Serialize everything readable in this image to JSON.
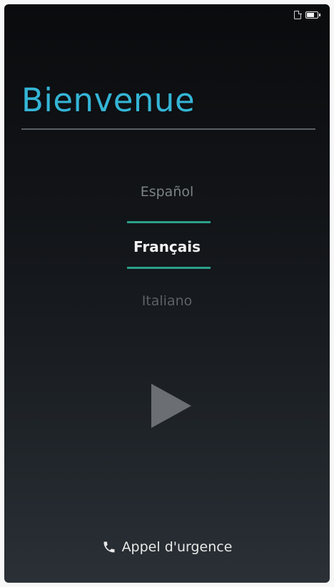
{
  "status_bar": {
    "icons": [
      "sim-icon",
      "battery-icon"
    ]
  },
  "welcome": {
    "title": "Bienvenue"
  },
  "language_picker": {
    "previous": "Español",
    "selected": "Français",
    "next": "Italiano",
    "accent_color": "#2ba08a"
  },
  "start_button": {
    "icon": "play-icon"
  },
  "emergency": {
    "icon": "phone-icon",
    "label": "Appel d'urgence"
  },
  "colors": {
    "title": "#34b5d6",
    "background_top": "#0a0b0d",
    "background_bottom": "#2a3036"
  }
}
